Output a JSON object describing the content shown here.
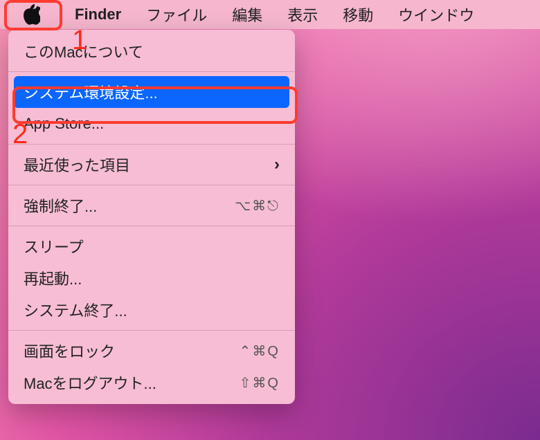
{
  "menubar": {
    "app_name": "Finder",
    "items": [
      {
        "label": "ファイル"
      },
      {
        "label": "編集"
      },
      {
        "label": "表示"
      },
      {
        "label": "移動"
      },
      {
        "label": "ウインドウ"
      }
    ]
  },
  "apple_menu": {
    "items": [
      {
        "label": "このMacについて",
        "selected": false
      },
      {
        "sep": true
      },
      {
        "label": "システム環境設定...",
        "selected": true
      },
      {
        "label": "App Store...",
        "selected": false
      },
      {
        "sep": true
      },
      {
        "label": "最近使った項目",
        "submenu": true
      },
      {
        "sep": true
      },
      {
        "label": "強制終了...",
        "shortcut": "⌥⌘⎋"
      },
      {
        "sep": true
      },
      {
        "label": "スリープ"
      },
      {
        "label": "再起動..."
      },
      {
        "label": "システム終了..."
      },
      {
        "sep": true
      },
      {
        "label": "画面をロック",
        "shortcut": "⌃⌘Q"
      },
      {
        "label": "Macをログアウト...",
        "shortcut": "⇧⌘Q"
      }
    ]
  },
  "annotations": {
    "step1": "1",
    "step2": "2"
  }
}
